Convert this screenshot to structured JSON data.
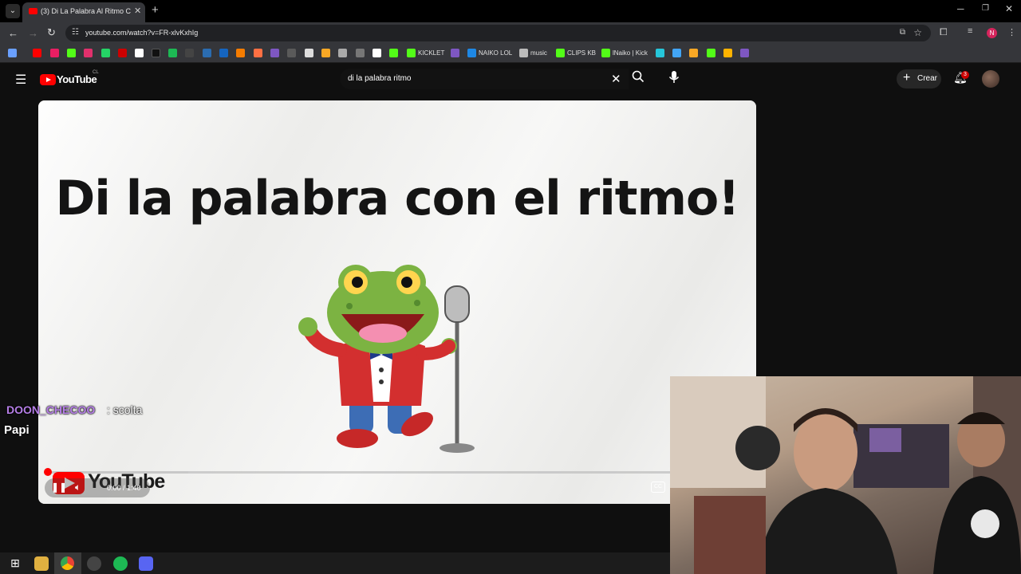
{
  "browser": {
    "tab_title": "(3) Di La Palabra Al Ritmo C",
    "url": "youtube.com/watch?v=FR-xlvKxhIg",
    "profile_initial": "N"
  },
  "bookmarks": [
    {
      "label": "KICKLET",
      "icon": "kicklet-icon"
    },
    {
      "label": "NAIKO LOL",
      "icon": "naiko-lol-icon"
    },
    {
      "label": "music",
      "icon": "music-icon"
    },
    {
      "label": "CLIPS KB",
      "icon": "clips-kb-icon"
    },
    {
      "label": "lNaiko | Kick",
      "icon": "kick-icon"
    }
  ],
  "youtube": {
    "logo_text": "YouTube",
    "country_code": "CL",
    "search_query": "di la palabra ritmo",
    "create_label": "Crear",
    "notification_count": "3"
  },
  "video": {
    "overlay_title": "Di la palabra con el ritmo!",
    "watermark_text": "YouTube",
    "time": "0:00 / 1:40",
    "progress_fraction": 0.005
  },
  "chat": {
    "username": "DOON_CHECOO",
    "message": ": scolta",
    "overlay_name": "Papi"
  },
  "colors": {
    "youtube_red": "#ff0000",
    "chat_username": "#b57ee6",
    "background": "#0f0f0f"
  }
}
